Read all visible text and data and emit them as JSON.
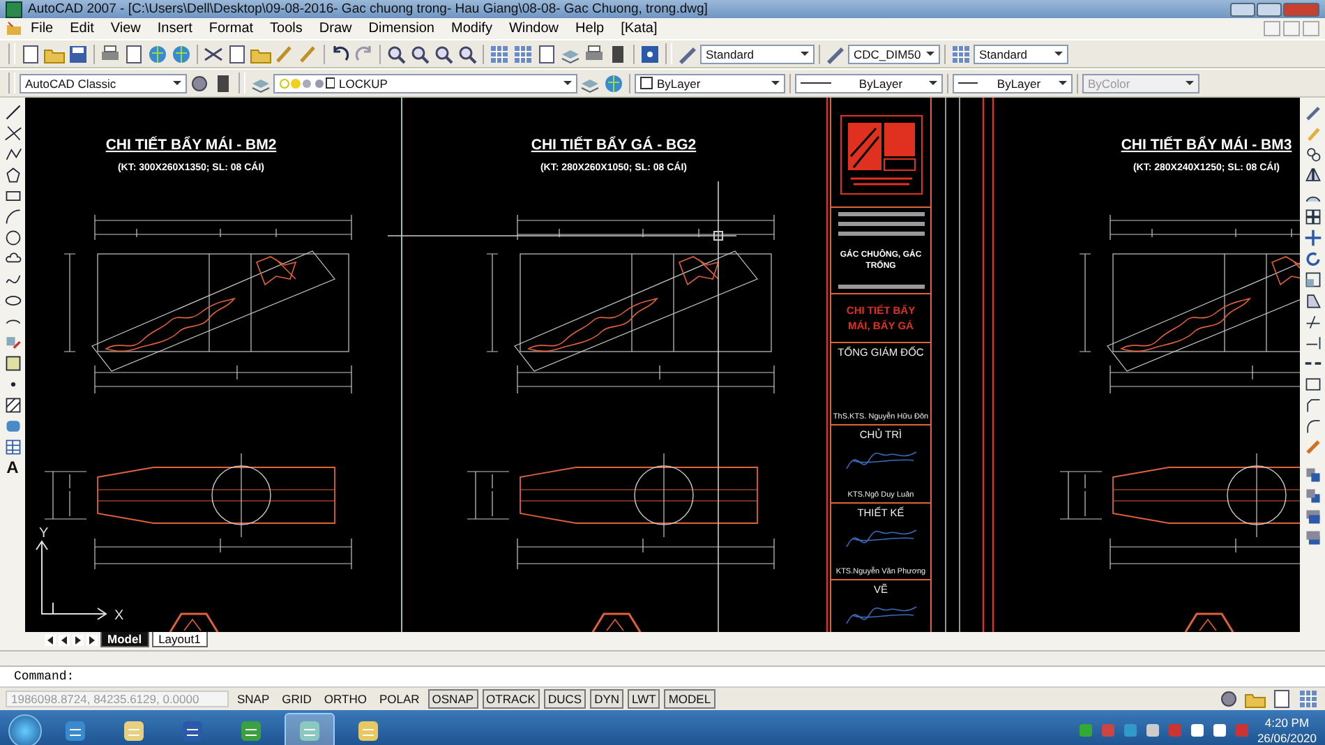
{
  "window": {
    "title": "AutoCAD 2007 - [C:\\Users\\Dell\\Desktop\\09-08-2016- Gac chuong trong- Hau Giang\\08-08- Gac Chuong, trong.dwg]"
  },
  "menu_bar": [
    "File",
    "Edit",
    "View",
    "Insert",
    "Format",
    "Tools",
    "Draw",
    "Dimension",
    "Modify",
    "Window",
    "Help",
    "[Kata]"
  ],
  "toolbars": {
    "text_style": "Standard",
    "dim_style": "CDC_DIM50",
    "table_style": "Standard",
    "workspace": "AutoCAD Classic",
    "layer": "LOCKUP",
    "color_control": "ByLayer",
    "linetype": "ByLayer",
    "lineweight": "ByLayer",
    "plot_style": {
      "value": "ByColor",
      "disabled": true
    }
  },
  "drawing": {
    "details": [
      {
        "title": "CHI TIẾT BẨY MÁI - BM2",
        "subtitle": "(KT: 300X260X1350; SL: 08 CÁI)"
      },
      {
        "title": "CHI TIẾT BẨY GÁ - BG2",
        "subtitle": "(KT: 280X260X1050; SL: 08 CÁI)"
      },
      {
        "title": "CHI TIẾT BẨY MÁI - BM3",
        "subtitle": "(KT: 280X240X1250; SL: 08 CÁI)"
      }
    ],
    "title_block": {
      "project_name": "GÁC CHUÔNG, GÁC TRỐNG",
      "sheet_name": "CHI TIẾT BẨY MÁI, BẨY GÁ",
      "roles": [
        {
          "role": "TỔNG GIÁM ĐỐC",
          "name": "ThS.KTS. Nguyễn Hữu Đôn"
        },
        {
          "role": "CHỦ TRÌ",
          "name": "KTS.Ngô Duy Luân"
        },
        {
          "role": "THIẾT KẾ",
          "name": "KTS.Nguyễn Văn Phương"
        },
        {
          "role": "VẼ"
        }
      ]
    },
    "ucs": {
      "y_label": "Y",
      "x_label": "X"
    }
  },
  "left_toolbar": {
    "text_tool": "A"
  },
  "layout_tabs": [
    {
      "label": "Model",
      "selected": true
    },
    {
      "label": "Layout1",
      "selected": false
    }
  ],
  "command_line": {
    "prompt": "Command:"
  },
  "status_bar": {
    "coordinates": "1986098.8724, 84235.6129, 0.0000",
    "toggles": [
      {
        "label": "SNAP",
        "on": false
      },
      {
        "label": "GRID",
        "on": false
      },
      {
        "label": "ORTHO",
        "on": false
      },
      {
        "label": "POLAR",
        "on": false
      },
      {
        "label": "OSNAP",
        "on": true
      },
      {
        "label": "OTRACK",
        "on": true
      },
      {
        "label": "DUCS",
        "on": true
      },
      {
        "label": "DYN",
        "on": true
      },
      {
        "label": "LWT",
        "on": true
      },
      {
        "label": "MODEL",
        "on": true
      }
    ]
  },
  "taskbar": {
    "time": "4:20 PM",
    "date": "26/06/2020"
  }
}
